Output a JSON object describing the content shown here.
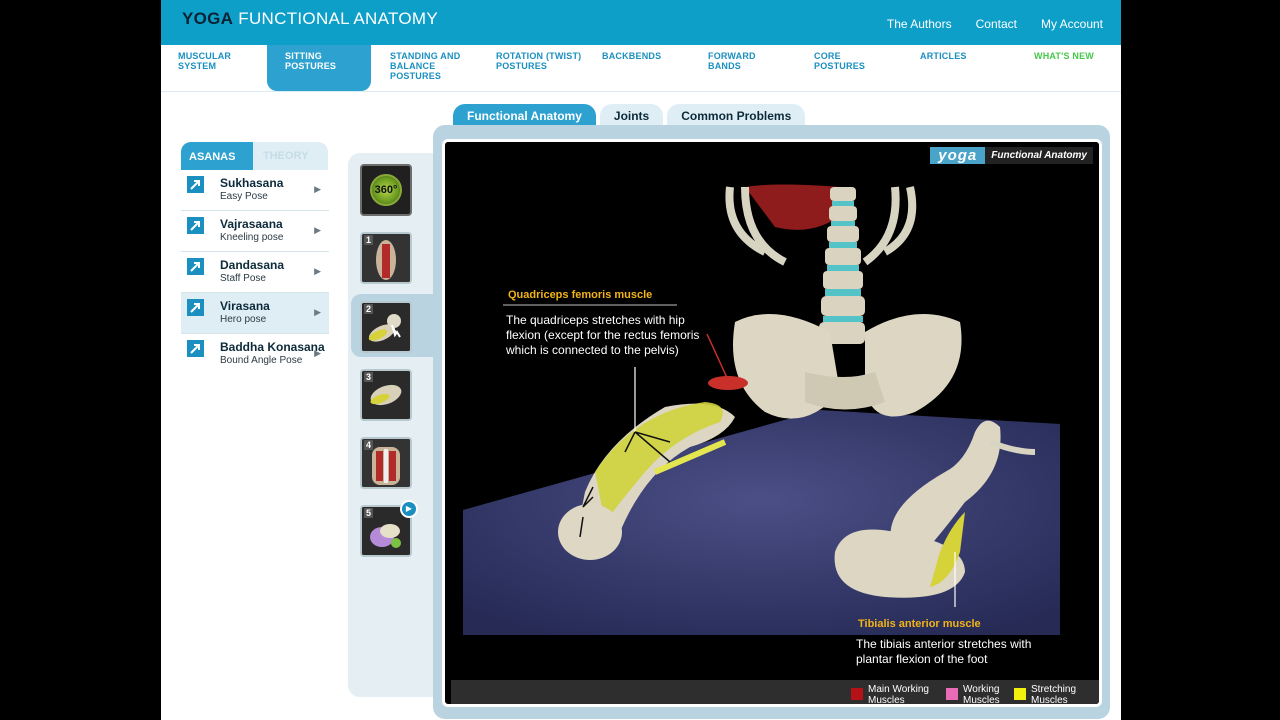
{
  "header": {
    "logo_bold": "YOGA",
    "logo_rest": "FUNCTIONAL ANATOMY",
    "links": [
      "The Authors",
      "Contact",
      "My Account"
    ]
  },
  "nav": {
    "items": [
      {
        "line1": "MUSCULAR",
        "line2": "SYSTEM",
        "line3": ""
      },
      {
        "line1": "SITTING",
        "line2": "POSTURES",
        "line3": ""
      },
      {
        "line1": "STANDING AND",
        "line2": "BALANCE",
        "line3": "POSTURES"
      },
      {
        "line1": "ROTATION (TWIST)",
        "line2": "POSTURES",
        "line3": ""
      },
      {
        "line1": "BACKBENDS",
        "line2": "",
        "line3": ""
      },
      {
        "line1": "FORWARD",
        "line2": "BANDS",
        "line3": ""
      },
      {
        "line1": "CORE",
        "line2": "POSTURES",
        "line3": ""
      },
      {
        "line1": "ARTICLES",
        "line2": "",
        "line3": ""
      },
      {
        "line1": "WHAT'S NEW",
        "line2": "",
        "line3": ""
      }
    ],
    "active_index": 1
  },
  "content_tabs": [
    "Functional Anatomy",
    "Joints",
    "Common Problems"
  ],
  "sidebar": {
    "tabs": [
      "ASANAS",
      "THEORY"
    ],
    "asanas": [
      {
        "name": "Sukhasana",
        "sub": "Easy Pose"
      },
      {
        "name": "Vajrasaana",
        "sub": "Kneeling pose"
      },
      {
        "name": "Dandasana",
        "sub": "Staff Pose"
      },
      {
        "name": "Virasana",
        "sub": "Hero pose"
      },
      {
        "name": "Baddha Konasana",
        "sub": "Bound Angle Pose"
      }
    ],
    "selected_index": 3
  },
  "thumbs": {
    "button_360": "360°",
    "numbers": [
      "1",
      "2",
      "3",
      "4",
      "5"
    ],
    "selected": "2"
  },
  "viewer": {
    "brand_yoga": "yoga",
    "brand_rest": "Functional Anatomy",
    "annotation1": {
      "title": "Quadriceps femoris muscle",
      "text": "The quadriceps stretches with hip flexion (except for the rectus femoris which is connected to the pelvis)"
    },
    "annotation2": {
      "title": "Tibialis anterior muscle",
      "text": "The tibiais anterior stretches with plantar flexion of the foot"
    },
    "legend": [
      {
        "label_line1": "Main Working",
        "label_line2": "Muscles",
        "color": "#b51218"
      },
      {
        "label_line1": "Working",
        "label_line2": "Muscles",
        "color": "#e96bb6"
      },
      {
        "label_line1": "Stretching",
        "label_line2": "Muscles",
        "color": "#f4f00e"
      }
    ]
  }
}
